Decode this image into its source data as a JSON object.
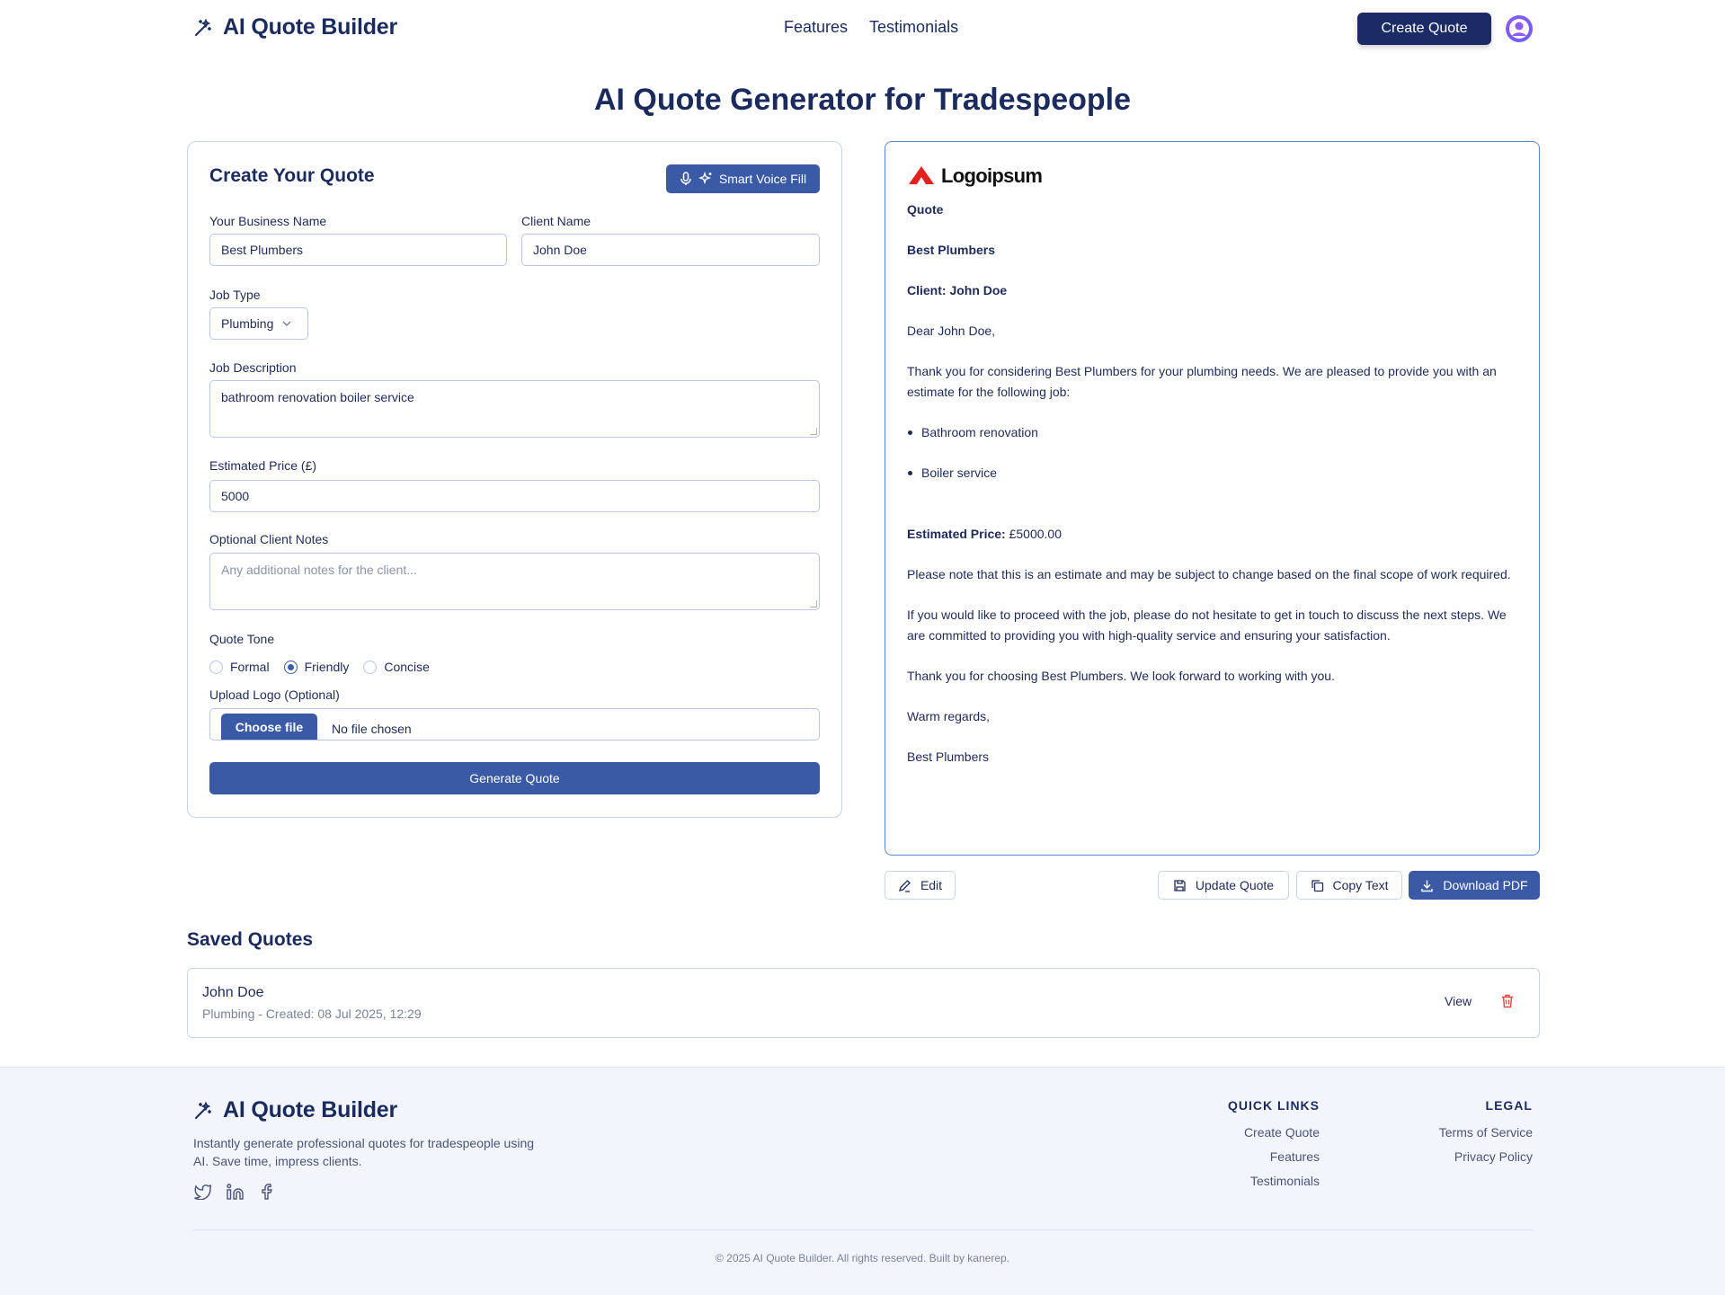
{
  "header": {
    "brand": "AI Quote Builder",
    "nav": [
      "Features",
      "Testimonials"
    ],
    "create_button": "Create Quote"
  },
  "page_title": "AI Quote Generator for Tradespeople",
  "form": {
    "title": "Create Your Quote",
    "voice_button": "Smart Voice Fill",
    "business_label": "Your Business Name",
    "business_value": "Best Plumbers",
    "client_label": "Client Name",
    "client_value": "John Doe",
    "job_type_label": "Job Type",
    "job_type_value": "Plumbing",
    "description_label": "Job Description",
    "description_value": "bathroom renovation boiler service",
    "price_label": "Estimated Price (£)",
    "price_value": "5000",
    "notes_label": "Optional Client Notes",
    "notes_placeholder": "Any additional notes for the client...",
    "tone_label": "Quote Tone",
    "tones": [
      "Formal",
      "Friendly",
      "Concise"
    ],
    "tone_selected": "Friendly",
    "logo_label": "Upload Logo (Optional)",
    "file_button": "Choose file",
    "file_status": "No file chosen",
    "generate_button": "Generate Quote"
  },
  "preview": {
    "logo_text": "Logoipsum",
    "heading": "Quote",
    "business": "Best Plumbers",
    "client": "Client: John Doe",
    "greeting": "Dear John Doe,",
    "intro": "Thank you for considering Best Plumbers for your plumbing needs. We are pleased to provide you with an estimate for the following job:",
    "jobs": [
      "Bathroom renovation",
      "Boiler service"
    ],
    "price_label": "Estimated Price:",
    "price_value": "£5000.00",
    "note": "Please note that this is an estimate and may be subject to change based on the final scope of work required.",
    "proceed": "If you would like to proceed with the job, please do not hesitate to get in touch to discuss the next steps. We are committed to providing you with high-quality service and ensuring your satisfaction.",
    "thanks": "Thank you for choosing Best Plumbers. We look forward to working with you.",
    "signoff": "Warm regards,",
    "signature": "Best Plumbers"
  },
  "actions": {
    "edit": "Edit",
    "update": "Update Quote",
    "copy": "Copy Text",
    "download": "Download PDF"
  },
  "saved": {
    "title": "Saved Quotes",
    "items": [
      {
        "name": "John Doe",
        "meta": "Plumbing - Created: 08 Jul 2025, 12:29",
        "view": "View"
      }
    ]
  },
  "footer": {
    "brand": "AI Quote Builder",
    "description": "Instantly generate professional quotes for tradespeople using AI. Save time, impress clients.",
    "quick_links_title": "QUICK LINKS",
    "quick_links": [
      "Create Quote",
      "Features",
      "Testimonials"
    ],
    "legal_title": "LEGAL",
    "legal_links": [
      "Terms of Service",
      "Privacy Policy"
    ],
    "copyright": "© 2025 AI Quote Builder. All rights reserved. Built by kanerep."
  },
  "colors": {
    "navy": "#1b2b66",
    "accent": "#3b5aa6",
    "danger": "#e04848",
    "footer_bg": "#f3f5fc"
  }
}
